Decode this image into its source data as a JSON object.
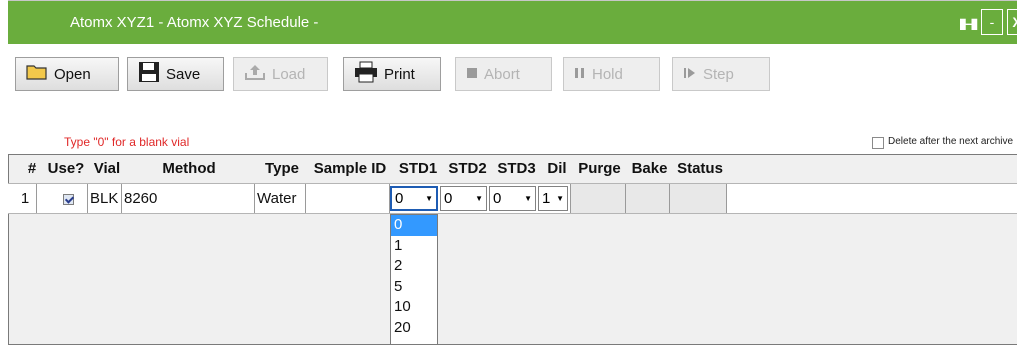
{
  "window": {
    "title": "Atomx XYZ1 - Atomx XYZ  Schedule -",
    "minimize_label": "-",
    "close_label": "X"
  },
  "toolbar": {
    "open_label": "Open",
    "save_label": "Save",
    "load_label": "Load",
    "print_label": "Print",
    "abort_label": "Abort",
    "hold_label": "Hold",
    "step_label": "Step"
  },
  "hint": "Type \"0\" for a blank vial",
  "delete_after_archive": {
    "label": "Delete after the next archive",
    "checked": false
  },
  "table": {
    "headers": [
      "#",
      "Use?",
      "Vial",
      "Method",
      "Type",
      "Sample ID",
      "STD1",
      "STD2",
      "STD3",
      "Dil",
      "Purge",
      "Bake",
      "Status"
    ],
    "rows": [
      {
        "num": "1",
        "use": true,
        "vial": "BLK",
        "method": "8260",
        "type": "Water",
        "sample_id": "",
        "std1": "0",
        "std2": "0",
        "std3": "0",
        "dil": "1",
        "purge": "",
        "bake": "",
        "status": ""
      }
    ]
  },
  "std1_dropdown": {
    "options": [
      "0",
      "1",
      "2",
      "5",
      "10",
      "20"
    ],
    "selected": "0"
  },
  "colors": {
    "titlebar": "#6aad3d",
    "hint": "#e02828",
    "selection": "#3399ff"
  }
}
